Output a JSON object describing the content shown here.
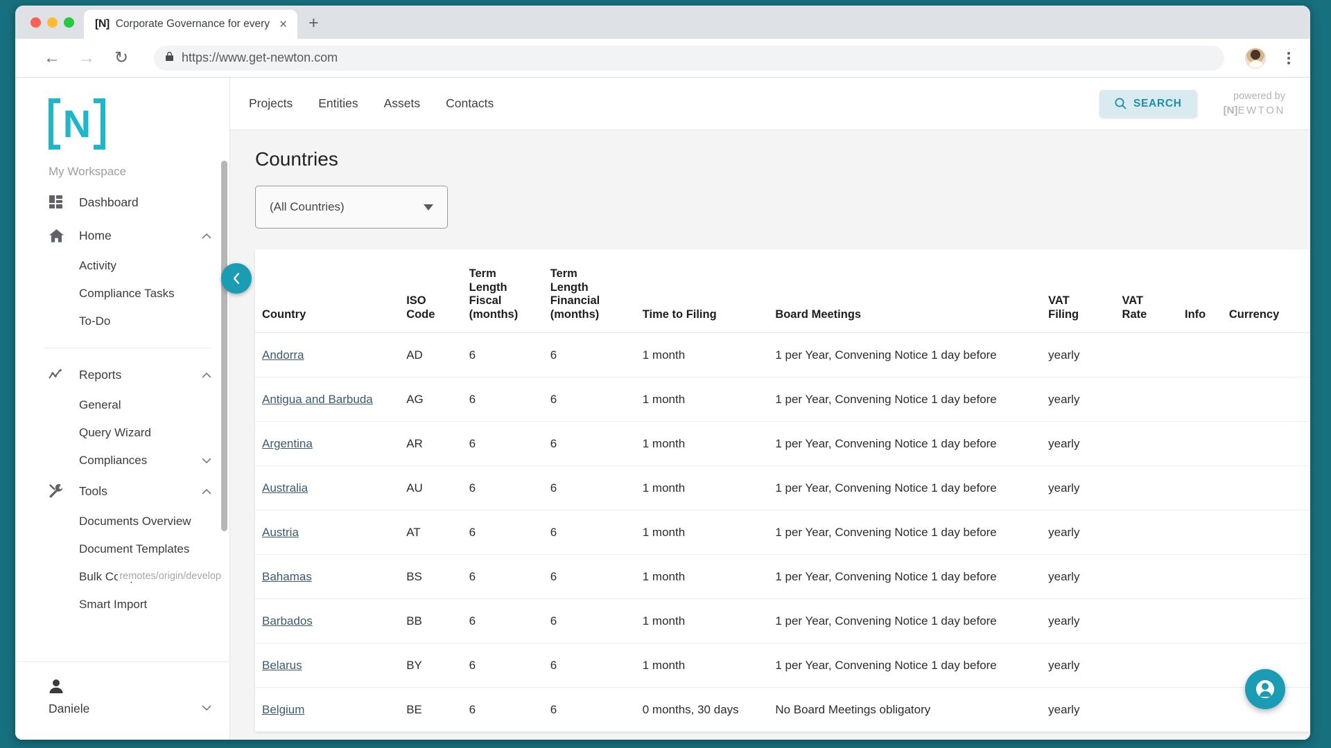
{
  "browser": {
    "tab": {
      "favicon": "[N]",
      "title": "Corporate Governance for every",
      "close_label": "×"
    },
    "new_tab_label": "+",
    "back_label": "←",
    "forward_label": "→",
    "reload_label": "↻",
    "lock_icon": "🔒",
    "url": "https://www.get-newton.com"
  },
  "sidebar": {
    "logo_letter": "N",
    "workspace_label": "My Workspace",
    "items": [
      {
        "label": "Dashboard",
        "icon": "dashboard-icon",
        "type": "item"
      },
      {
        "label": "Home",
        "icon": "home-icon",
        "type": "item",
        "chevron": "⌃"
      },
      {
        "label": "Activity",
        "type": "sub"
      },
      {
        "label": "Compliance Tasks",
        "type": "sub"
      },
      {
        "label": "To-Do",
        "type": "sub"
      },
      {
        "label": "Reports",
        "icon": "reports-icon",
        "type": "item",
        "chevron": "⌃"
      },
      {
        "label": "General",
        "type": "sub"
      },
      {
        "label": "Query Wizard",
        "type": "sub"
      },
      {
        "label": "Compliances",
        "type": "sub",
        "chevron": "⌄"
      },
      {
        "label": "Tools",
        "icon": "tools-icon",
        "type": "item",
        "chevron": "⌃"
      },
      {
        "label": "Documents Overview",
        "type": "sub"
      },
      {
        "label": "Document Templates",
        "type": "sub"
      },
      {
        "label": "Bulk Compliances",
        "type": "sub"
      },
      {
        "label": "Smart Import",
        "type": "sub"
      }
    ],
    "branch_tag": "remotes/origin/develop",
    "user": {
      "name": "Daniele",
      "caret": "▾"
    }
  },
  "topbar": {
    "nav": [
      "Projects",
      "Entities",
      "Assets",
      "Contacts"
    ],
    "search_label": "SEARCH",
    "powered_by": "powered by",
    "brand_bracket": "[N]",
    "brand_rest": "EWTON"
  },
  "page": {
    "title": "Countries",
    "country_filter": {
      "value": "(All Countries)",
      "caret": "▾"
    }
  },
  "table": {
    "columns": [
      "Country",
      "ISO Code",
      "Term Length Fiscal (months)",
      "Term Length Financial (months)",
      "Time to Filing",
      "Board Meetings",
      "VAT Filing",
      "VAT Rate",
      "Info",
      "Currency"
    ],
    "columns_html": [
      "Country",
      "ISO<br>Code",
      "Term<br>Length<br>Fiscal<br>(months)",
      "Term<br>Length<br>Financial<br>(months)",
      "Time to Filing",
      "Board Meetings",
      "VAT<br>Filing",
      "VAT<br>Rate",
      "Info",
      "Currency"
    ],
    "rows": [
      {
        "country": "Andorra",
        "iso": "AD",
        "fiscal": "6",
        "financial": "6",
        "filing": "1 month",
        "meetings": "1 per Year, Convening Notice 1 day before",
        "vat_filing": "yearly",
        "vat_rate": "",
        "info": "",
        "currency": ""
      },
      {
        "country": "Antigua and Barbuda",
        "iso": "AG",
        "fiscal": "6",
        "financial": "6",
        "filing": "1 month",
        "meetings": "1 per Year, Convening Notice 1 day before",
        "vat_filing": "yearly",
        "vat_rate": "",
        "info": "",
        "currency": ""
      },
      {
        "country": "Argentina",
        "iso": "AR",
        "fiscal": "6",
        "financial": "6",
        "filing": "1 month",
        "meetings": "1 per Year, Convening Notice 1 day before",
        "vat_filing": "yearly",
        "vat_rate": "",
        "info": "",
        "currency": ""
      },
      {
        "country": "Australia",
        "iso": "AU",
        "fiscal": "6",
        "financial": "6",
        "filing": "1 month",
        "meetings": "1 per Year, Convening Notice 1 day before",
        "vat_filing": "yearly",
        "vat_rate": "",
        "info": "",
        "currency": ""
      },
      {
        "country": "Austria",
        "iso": "AT",
        "fiscal": "6",
        "financial": "6",
        "filing": "1 month",
        "meetings": "1 per Year, Convening Notice 1 day before",
        "vat_filing": "yearly",
        "vat_rate": "",
        "info": "",
        "currency": ""
      },
      {
        "country": "Bahamas",
        "iso": "BS",
        "fiscal": "6",
        "financial": "6",
        "filing": "1 month",
        "meetings": "1 per Year, Convening Notice 1 day before",
        "vat_filing": "yearly",
        "vat_rate": "",
        "info": "",
        "currency": ""
      },
      {
        "country": "Barbados",
        "iso": "BB",
        "fiscal": "6",
        "financial": "6",
        "filing": "1 month",
        "meetings": "1 per Year, Convening Notice 1 day before",
        "vat_filing": "yearly",
        "vat_rate": "",
        "info": "",
        "currency": ""
      },
      {
        "country": "Belarus",
        "iso": "BY",
        "fiscal": "6",
        "financial": "6",
        "filing": "1 month",
        "meetings": "1 per Year, Convening Notice 1 day before",
        "vat_filing": "yearly",
        "vat_rate": "",
        "info": "",
        "currency": ""
      },
      {
        "country": "Belgium",
        "iso": "BE",
        "fiscal": "6",
        "financial": "6",
        "filing": "0 months, 30 days",
        "meetings": "No Board Meetings obligatory",
        "vat_filing": "yearly",
        "vat_rate": "",
        "info": "",
        "currency": ""
      }
    ]
  },
  "widgets": {
    "collapse_icon": "chevron-left-icon",
    "fab_icon": "support-agent-icon"
  },
  "colors": {
    "accent": "#1a9cb5",
    "logo": "#1eb7c9",
    "search_bg": "#d9eaf0",
    "link": "#3d5a6c"
  }
}
